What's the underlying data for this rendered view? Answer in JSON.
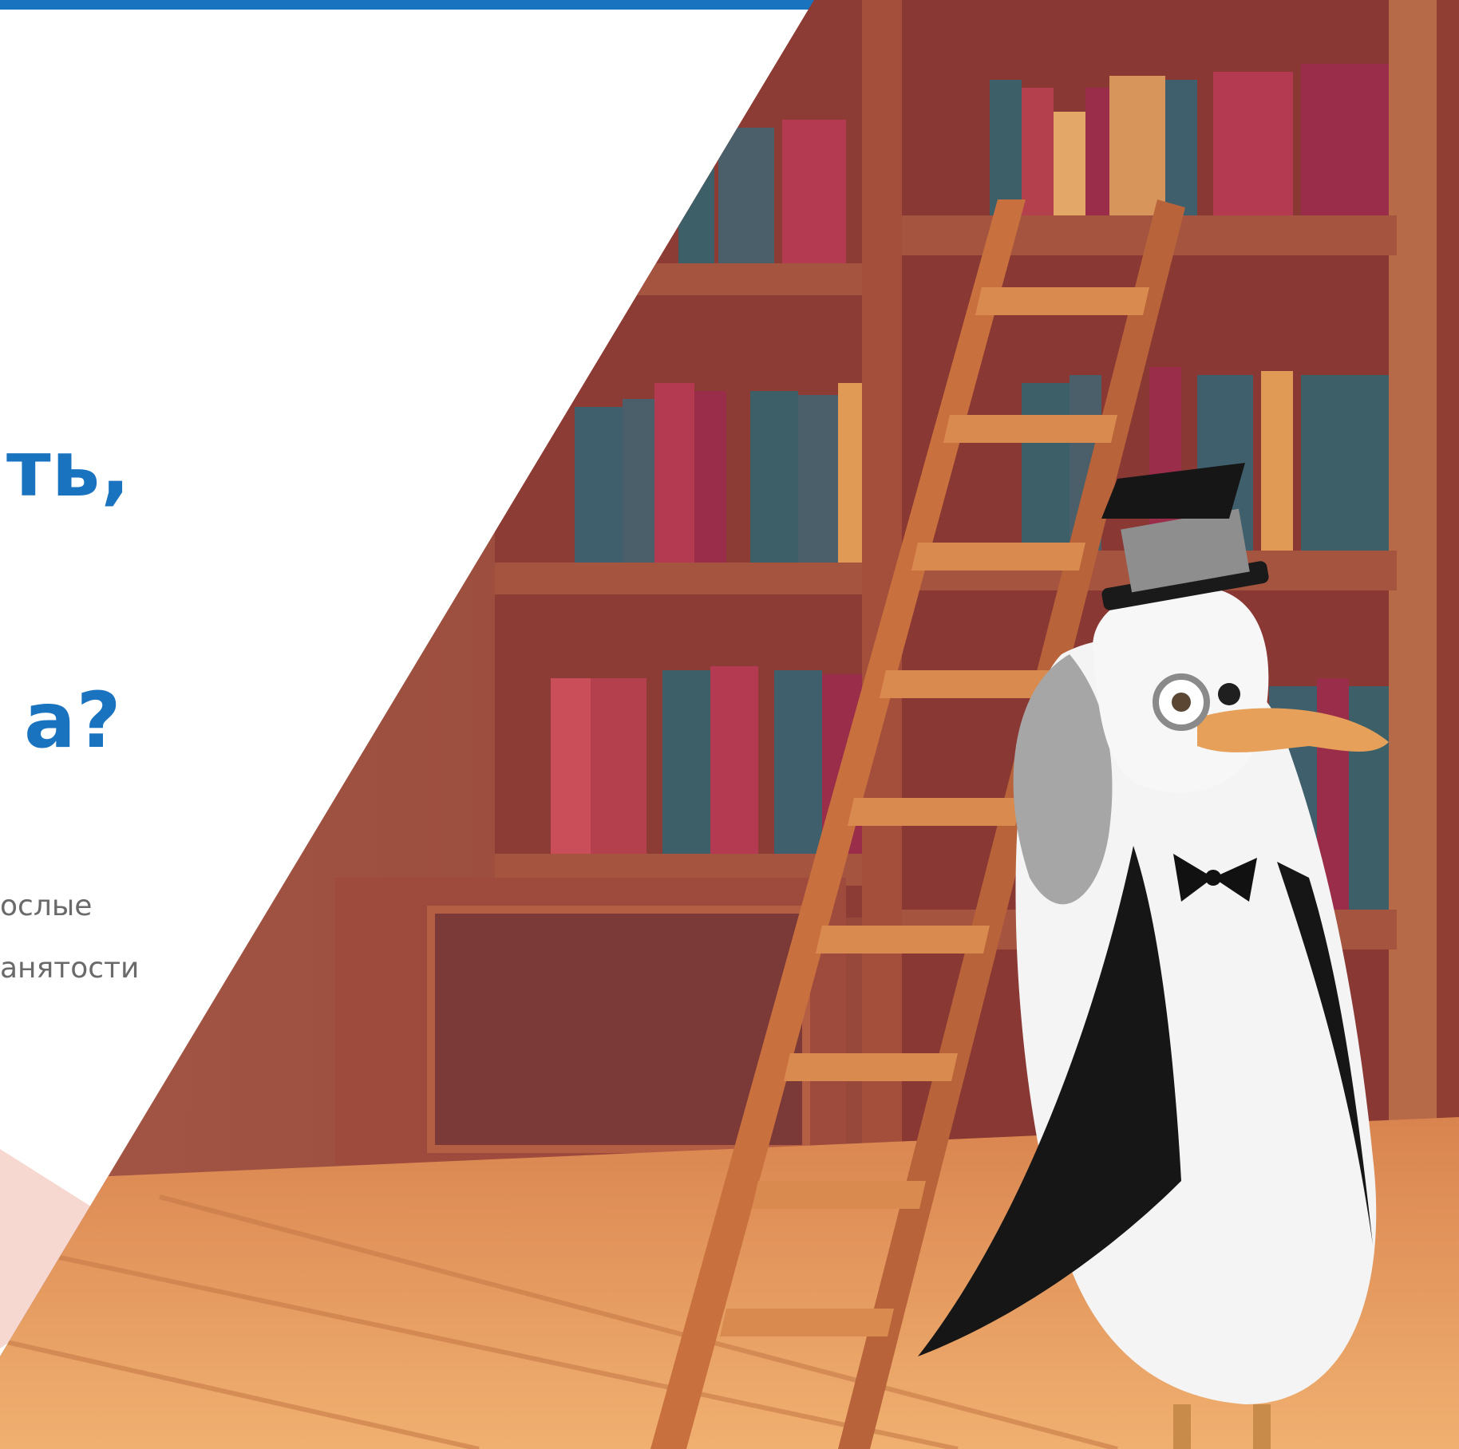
{
  "hero": {
    "headline_line1": "ть,",
    "headline_line2": "а?",
    "subtitle_line1": "ослые",
    "subtitle_line2": "анятости"
  },
  "colors": {
    "accent": "#1a73bf",
    "subtitle": "#6a6a6a"
  },
  "icons": [
    "library-illustration",
    "seagull-mascot-illustration",
    "ladder-illustration"
  ]
}
